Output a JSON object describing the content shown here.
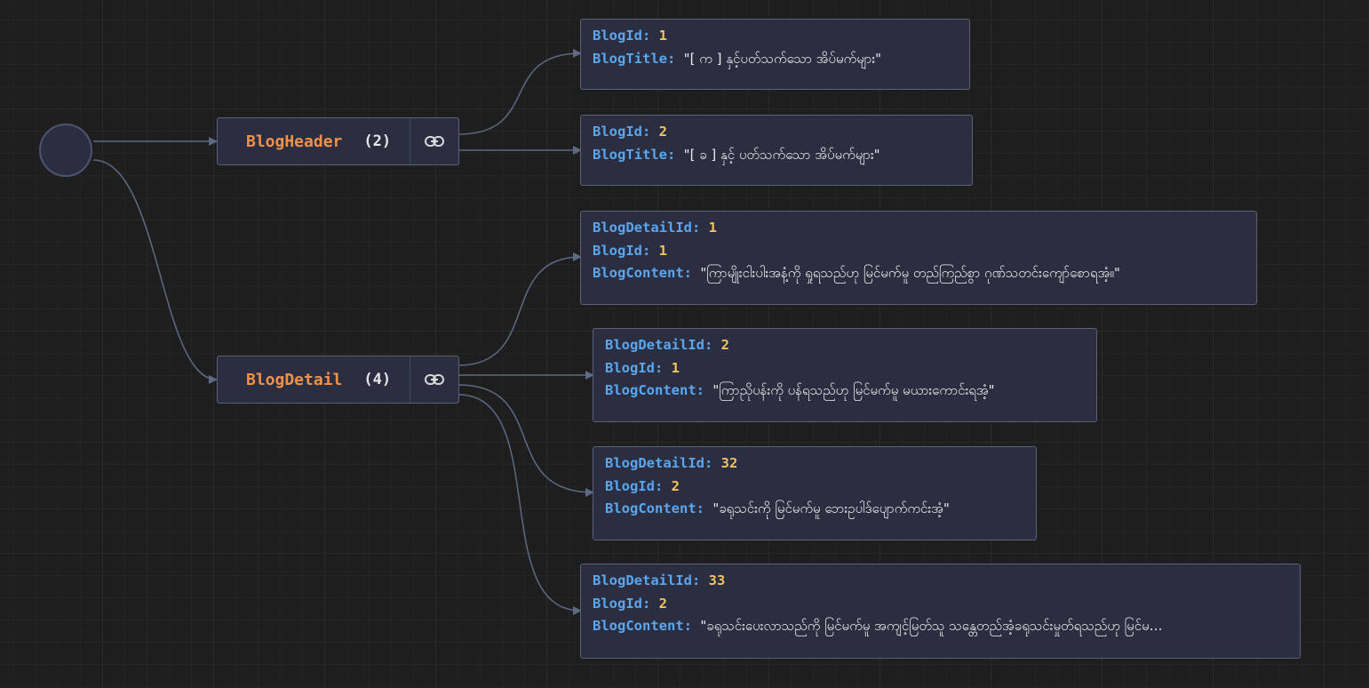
{
  "root": {
    "objects": [
      {
        "name": "BlogHeader",
        "count_label": "(2)",
        "items": [
          {
            "fields": [
              {
                "key": "BlogId:",
                "value": "1",
                "kind": "num"
              },
              {
                "key": "BlogTitle:",
                "value": "\"[ က ] နှင့်ပတ်သက်သော အိပ်မက်များ\"",
                "kind": "str"
              }
            ]
          },
          {
            "fields": [
              {
                "key": "BlogId:",
                "value": "2",
                "kind": "num"
              },
              {
                "key": "BlogTitle:",
                "value": "\"[ ခ ] နှင့် ပတ်သက်သော အိပ်မက်များ\"",
                "kind": "str"
              }
            ]
          }
        ]
      },
      {
        "name": "BlogDetail",
        "count_label": "(4)",
        "items": [
          {
            "fields": [
              {
                "key": "BlogDetailId:",
                "value": "1",
                "kind": "num"
              },
              {
                "key": "BlogId:",
                "value": "1",
                "kind": "num"
              },
              {
                "key": "BlogContent:",
                "value": "\"ကြာမျိုးငါးပါးအနံ့ကို ရှုရသည်ဟု မြင်မက်မူ တည်ကြည်စွာ ဂုဏ်သတင်းကျော်စောရအံ့။\"",
                "kind": "str"
              }
            ]
          },
          {
            "fields": [
              {
                "key": "BlogDetailId:",
                "value": "2",
                "kind": "num"
              },
              {
                "key": "BlogId:",
                "value": "1",
                "kind": "num"
              },
              {
                "key": "BlogContent:",
                "value": "\"ကြာညိုပန်းကို ပန်ရသည်ဟု မြင်မက်မူ မယားကောင်းရအံ့\"",
                "kind": "str"
              }
            ]
          },
          {
            "fields": [
              {
                "key": "BlogDetailId:",
                "value": "32",
                "kind": "num"
              },
              {
                "key": "BlogId:",
                "value": "2",
                "kind": "num"
              },
              {
                "key": "BlogContent:",
                "value": "\"ခရုသင်းကို မြင်မက်မူ ဘေးဥပါဒ်ပျောက်ကင်းအံ့\"",
                "kind": "str"
              }
            ]
          },
          {
            "fields": [
              {
                "key": "BlogDetailId:",
                "value": "33",
                "kind": "num"
              },
              {
                "key": "BlogId:",
                "value": "2",
                "kind": "num"
              },
              {
                "key": "BlogContent:",
                "value": "\"ခရုသင်းပေးလာသည်ကို မြင်မက်မူ အကျင့်မြတ်သူ သန္တေတည်အံ့ခရုသင်းမှုတ်ရသည်ဟု မြင်မ…",
                "kind": "str"
              }
            ]
          }
        ]
      }
    ]
  },
  "colors": {
    "background": "#1e1e1e",
    "node_fill": "#2b2e40",
    "node_border": "#5b6275",
    "edge": "#5d6a85",
    "object_name": "#f0914a",
    "key": "#5aa6ef",
    "number": "#f5c25c",
    "string": "#ececec"
  },
  "icons": {
    "node_link": "link-icon"
  }
}
